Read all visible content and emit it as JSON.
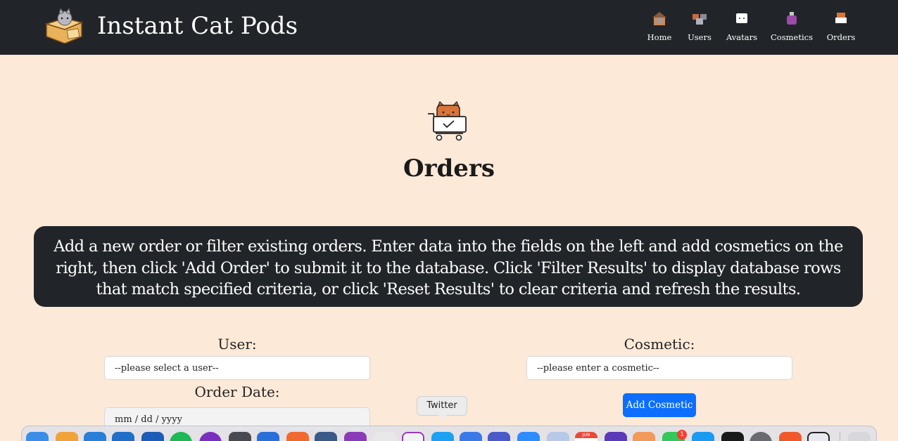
{
  "app": {
    "brand_title": "Instant Cat Pods"
  },
  "nav": {
    "items": [
      {
        "label": "Home",
        "icon": "cat-house-icon"
      },
      {
        "label": "Users",
        "icon": "cats-users-icon"
      },
      {
        "label": "Avatars",
        "icon": "cat-avatar-icon"
      },
      {
        "label": "Cosmetics",
        "icon": "cat-cosmetics-icon"
      },
      {
        "label": "Orders",
        "icon": "cat-cart-icon"
      }
    ]
  },
  "page": {
    "title": "Orders",
    "instructions": "Add a new order or filter existing orders. Enter data into the fields on the left and add cosmetics on the right, then click 'Add Order' to submit it to the database. Click 'Filter Results' to display database rows that match specified criteria, or click 'Reset Results' to clear criteria and refresh the results."
  },
  "form": {
    "user_label": "User:",
    "user_placeholder": "--please select a user--",
    "order_date_label": "Order Date:",
    "order_date_placeholder": "mm / dd / yyyy",
    "cosmetic_label": "Cosmetic:",
    "cosmetic_placeholder": "--please enter a cosmetic--",
    "add_cosmetic_button": "Add Cosmetic"
  },
  "dock": {
    "tooltip": "Twitter",
    "badge_count": "1",
    "calendar_month": "JUN"
  },
  "colors": {
    "navbar": "#212529",
    "background": "#fde9d8",
    "primary_button": "#0d6efd"
  }
}
